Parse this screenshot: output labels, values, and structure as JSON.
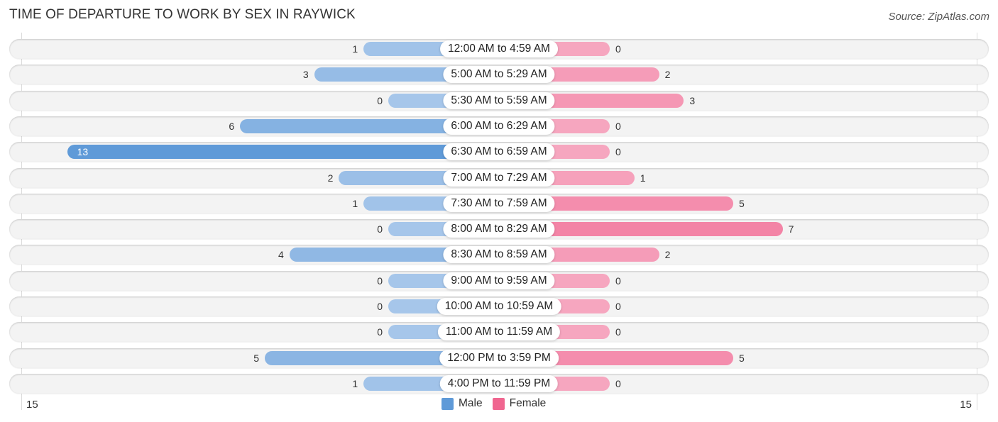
{
  "title": "TIME OF DEPARTURE TO WORK BY SEX IN RAYWICK",
  "source": "Source: ZipAtlas.com",
  "colors": {
    "male_light": "#a6c6ea",
    "male_dark": "#5f9ad8",
    "female_light": "#f6a6bf",
    "female_dark": "#f06690",
    "row_bg": "#f3f3f3"
  },
  "chart_data": {
    "type": "bar",
    "orientation": "horizontal-diverging",
    "title": "TIME OF DEPARTURE TO WORK BY SEX IN RAYWICK",
    "categories": [
      "12:00 AM to 4:59 AM",
      "5:00 AM to 5:29 AM",
      "5:30 AM to 5:59 AM",
      "6:00 AM to 6:29 AM",
      "6:30 AM to 6:59 AM",
      "7:00 AM to 7:29 AM",
      "7:30 AM to 7:59 AM",
      "8:00 AM to 8:29 AM",
      "8:30 AM to 8:59 AM",
      "9:00 AM to 9:59 AM",
      "10:00 AM to 10:59 AM",
      "11:00 AM to 11:59 AM",
      "12:00 PM to 3:59 PM",
      "4:00 PM to 11:59 PM"
    ],
    "series": [
      {
        "name": "Male",
        "values": [
          1,
          3,
          0,
          6,
          13,
          2,
          1,
          0,
          4,
          0,
          0,
          0,
          5,
          1
        ]
      },
      {
        "name": "Female",
        "values": [
          0,
          2,
          3,
          0,
          0,
          1,
          5,
          7,
          2,
          0,
          0,
          0,
          5,
          0
        ]
      }
    ],
    "axis": {
      "left_label": "15",
      "right_label": "15",
      "range": [
        -15,
        15
      ]
    },
    "legend": {
      "items": [
        "Male",
        "Female"
      ],
      "placement": "bottom-center"
    },
    "grid": false
  }
}
